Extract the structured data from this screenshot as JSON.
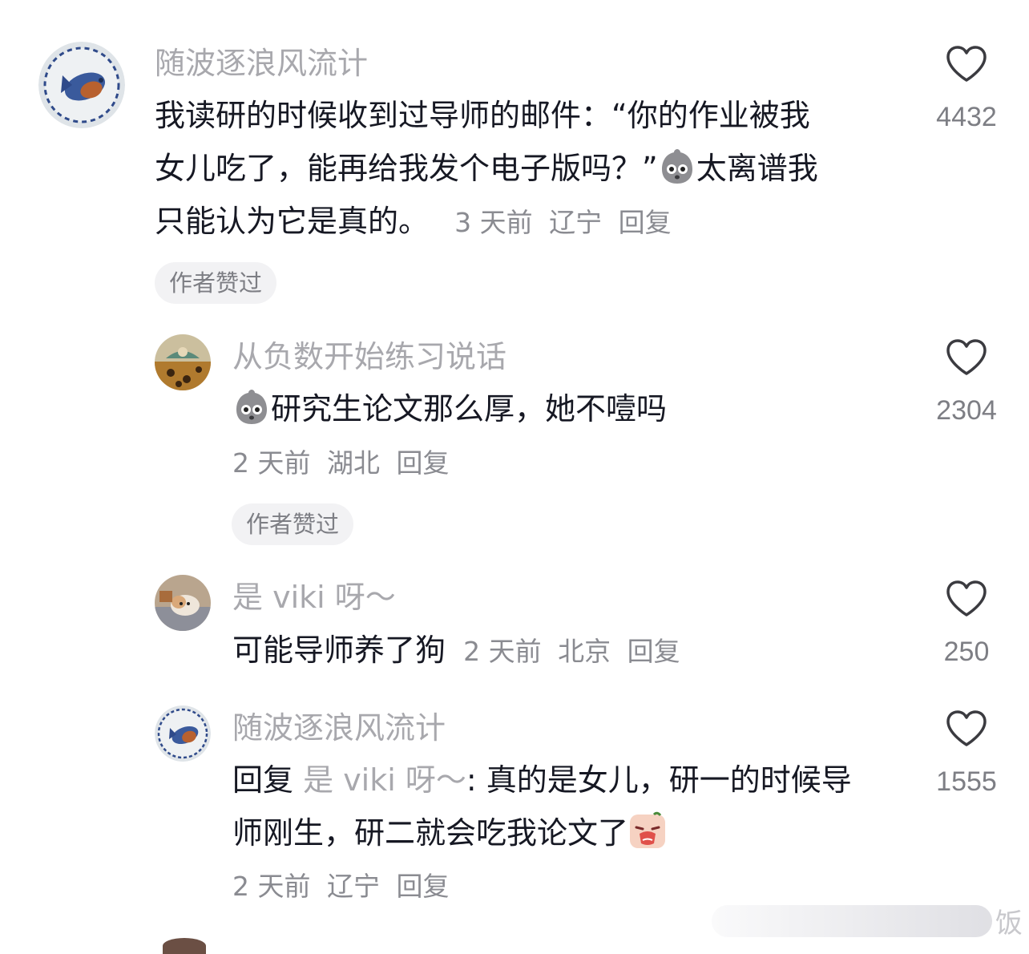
{
  "comments": [
    {
      "username": "随波逐浪风流计",
      "text_line1": "我读研的时候收到过导师的邮件：“你的作业被我",
      "text_line2a": "女儿吃了，能再给我发个电子版吗？”",
      "text_line2b": "太离谱我",
      "text_line3": "只能认为它是真的。",
      "time": "3 天前",
      "location": "辽宁",
      "reply": "回复",
      "badge": "作者赞过",
      "likes": "4432"
    },
    {
      "username": "从负数开始练习说话",
      "text": "研究生论文那么厚，她不噎吗",
      "time": "2 天前",
      "location": "湖北",
      "reply": "回复",
      "badge": "作者赞过",
      "likes": "2304"
    },
    {
      "username": "是 viki 呀～",
      "text": "可能导师养了狗",
      "time": "2 天前",
      "location": "北京",
      "reply": "回复",
      "likes": "250"
    },
    {
      "username": "随波逐浪风流计",
      "reply_prefix": "回复",
      "mention": "是 viki 呀～",
      "text_line1": ": 真的是女儿，研一的时候导",
      "text_line2": "师刚生，研二就会吃我论文了",
      "time": "2 天前",
      "location": "辽宁",
      "reply": "回复",
      "likes": "1555"
    }
  ],
  "icons": {
    "like": "heart-outline-icon",
    "emoji_shocked": "shocked-face-emoji",
    "emoji_crying": "crying-face-emoji"
  },
  "watermark": {
    "text": "饭"
  },
  "colors": {
    "username": "#a8a8ad",
    "text": "#161823",
    "meta": "#8a8b91",
    "badge_bg": "#f2f2f4"
  }
}
